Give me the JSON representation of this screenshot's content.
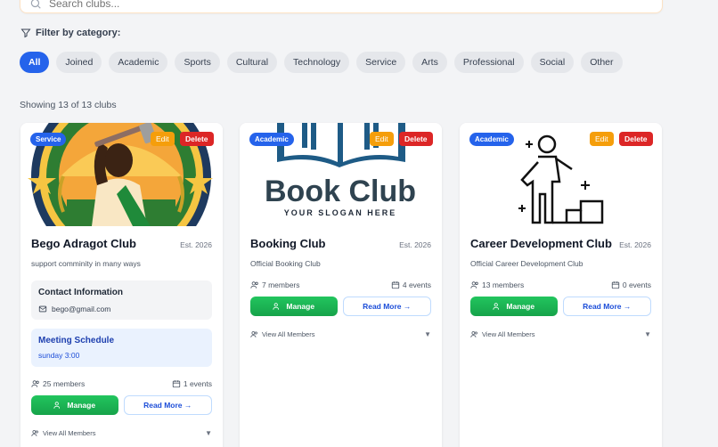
{
  "search": {
    "placeholder": "Search clubs..."
  },
  "filter": {
    "label": "Filter by category:",
    "categories": [
      "All",
      "Joined",
      "Academic",
      "Sports",
      "Cultural",
      "Technology",
      "Service",
      "Arts",
      "Professional",
      "Social",
      "Other"
    ],
    "selected": "All"
  },
  "showing_text": "Showing 13 of 13 clubs",
  "card_actions": {
    "edit": "Edit",
    "delete": "Delete",
    "manage": "Manage",
    "read_more": "Read More →",
    "view_members": "View All Members"
  },
  "clubs": [
    {
      "category": "Service",
      "name": "Bego Adragot Club",
      "est": "Est. 2026",
      "description": "support comminity in many ways",
      "contact_title": "Contact Information",
      "email": "bego@gmail.com",
      "meeting_title": "Meeting Schedule",
      "meeting_time": "sunday 3:00",
      "members": "25 members",
      "events": "1 events"
    },
    {
      "category": "Academic",
      "name": "Booking Club",
      "est": "Est. 2026",
      "description": "Official Booking Club",
      "logo_title": "Book Club",
      "logo_slogan": "YOUR SLOGAN HERE",
      "members": "7 members",
      "events": "4 events"
    },
    {
      "category": "Academic",
      "name": "Career Development Club",
      "est": "Est. 2026",
      "description": "Official Career Development Club",
      "members": "13 members",
      "events": "0 events"
    }
  ],
  "colors": {
    "primary": "#2563eb",
    "edit": "#f59e0b",
    "delete": "#dc2626",
    "manage": "#16a34a"
  }
}
